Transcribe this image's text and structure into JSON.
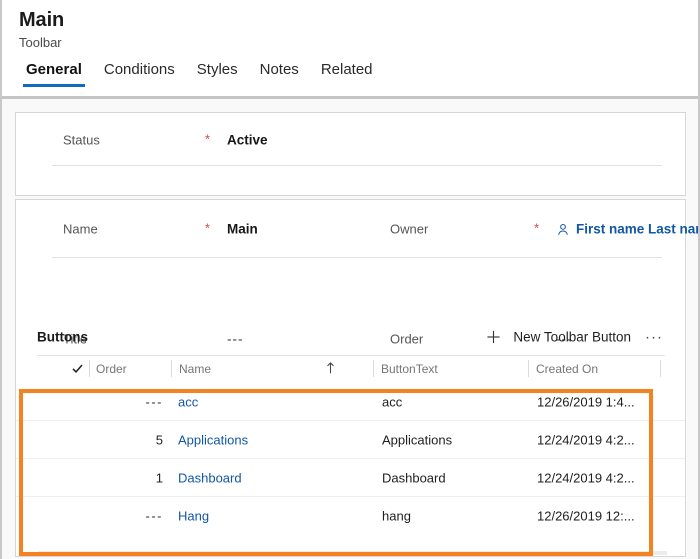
{
  "header": {
    "record_title": "Main",
    "record_subtitle": "Toolbar",
    "tabs": [
      {
        "label": "General",
        "active": true
      },
      {
        "label": "Conditions",
        "active": false
      },
      {
        "label": "Styles",
        "active": false
      },
      {
        "label": "Notes",
        "active": false
      },
      {
        "label": "Related",
        "active": false
      }
    ]
  },
  "status_card": {
    "label": "Status",
    "required_marker": "*",
    "value": "Active"
  },
  "main_card": {
    "rows": [
      {
        "left_label": "Name",
        "left_required": "*",
        "left_value": "Main",
        "right_label": "Owner",
        "right_required": "*",
        "right_value": "First name Last name",
        "right_icon": "person-icon"
      },
      {
        "left_label": "Title",
        "left_required": "",
        "left_value": "---",
        "right_label": "Order",
        "right_required": "",
        "right_value": "---",
        "right_icon": ""
      }
    ]
  },
  "subgrid": {
    "title": "Buttons",
    "command_bar": {
      "new_icon": "plus-icon",
      "new_label": "New Toolbar Button",
      "overflow_label": "···"
    },
    "columns": [
      {
        "label": "",
        "icon": "checkmark-icon"
      },
      {
        "label": "Order",
        "icon": ""
      },
      {
        "label": "Name",
        "icon": "sort-ascending-icon"
      },
      {
        "label": "ButtonText",
        "icon": ""
      },
      {
        "label": "Created On",
        "icon": ""
      }
    ],
    "rows": [
      {
        "order": "---",
        "name": "acc",
        "button_text": "acc",
        "created_on": "12/26/2019 1:4..."
      },
      {
        "order": "5",
        "name": "Applications",
        "button_text": "Applications",
        "created_on": "12/24/2019 4:2..."
      },
      {
        "order": "1",
        "name": "Dashboard",
        "button_text": "Dashboard",
        "created_on": "12/24/2019 4:2..."
      },
      {
        "order": "---",
        "name": "Hang",
        "button_text": "hang",
        "created_on": "12/26/2019 12:..."
      }
    ]
  },
  "annotation": {
    "highlight_color": "#f58220",
    "accent_color": "#0f6cbd",
    "link_color": "#1257a5",
    "required_color": "#e8453c"
  }
}
